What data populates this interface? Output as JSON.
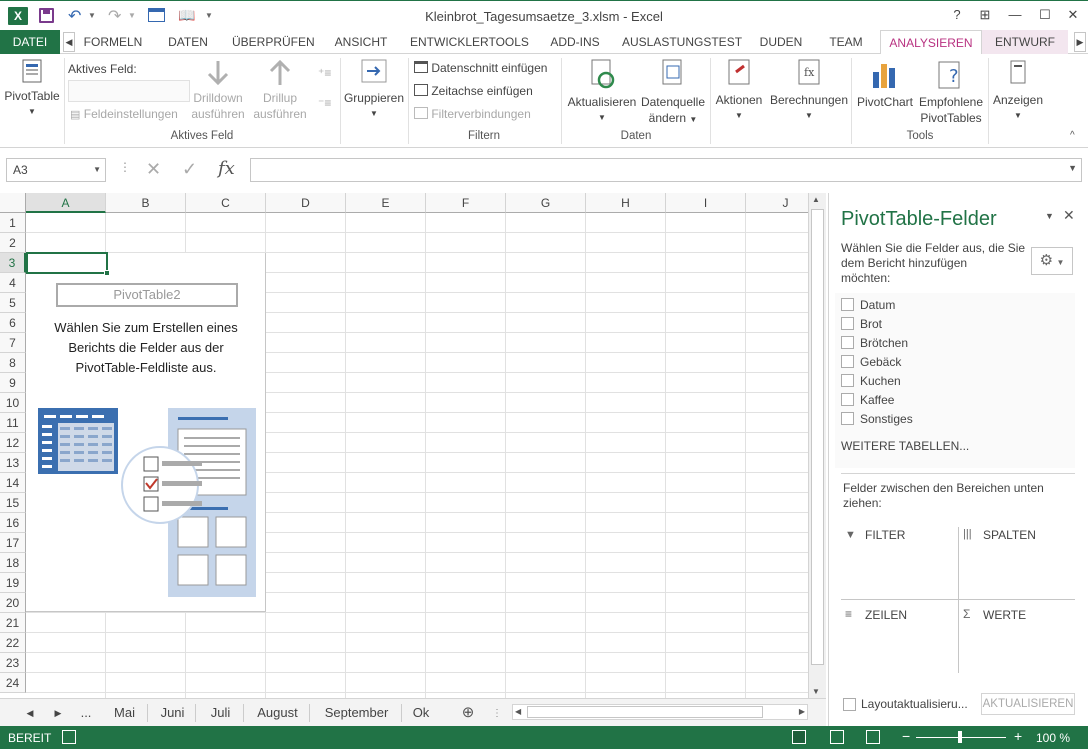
{
  "window": {
    "title": "Kleinbrot_Tagesumsaetze_3.xlsm - Excel",
    "help": "?",
    "ribbon_display": "⊞",
    "minimize": "—",
    "maximize": "☐",
    "close": "✕"
  },
  "tabs": [
    {
      "label": "DATEI"
    },
    {
      "label": "FORMELN"
    },
    {
      "label": "DATEN"
    },
    {
      "label": "ÜBERPRÜFEN"
    },
    {
      "label": "ANSICHT"
    },
    {
      "label": "ENTWICKLERTOOLS"
    },
    {
      "label": "ADD-INS"
    },
    {
      "label": "AUSLASTUNGSTEST"
    },
    {
      "label": "DUDEN"
    },
    {
      "label": "TEAM"
    },
    {
      "label": "ANALYSIEREN"
    },
    {
      "label": "ENTWURF"
    }
  ],
  "ribbon": {
    "pivottable": "PivotTable",
    "active_field_label": "Aktives Feld:",
    "field_settings": "Feldeinstellungen",
    "drilldown_1": "Drilldown",
    "drilldown_2": "ausführen",
    "drillup_1": "Drillup",
    "drillup_2": "ausführen",
    "group_active_field": "Aktives Feld",
    "gruppieren": "Gruppieren",
    "slicer": "Datenschnitt einfügen",
    "timeline": "Zeitachse einfügen",
    "filter_conn": "Filterverbindungen",
    "group_filter": "Filtern",
    "refresh": "Aktualisieren",
    "datasource_1": "Datenquelle",
    "datasource_2": "ändern",
    "group_daten": "Daten",
    "actions": "Aktionen",
    "calculations": "Berechnungen",
    "pivotchart": "PivotChart",
    "recommended_1": "Empfohlene",
    "recommended_2": "PivotTables",
    "group_tools": "Tools",
    "show": "Anzeigen"
  },
  "formula_bar": {
    "name_box": "A3",
    "cancel_icon": "✕",
    "enter_icon": "✓",
    "fx": "fx",
    "value": ""
  },
  "grid": {
    "columns": [
      "A",
      "B",
      "C",
      "D",
      "E",
      "F",
      "G",
      "H",
      "I",
      "J"
    ],
    "rows": [
      "1",
      "2",
      "3",
      "4",
      "5",
      "6",
      "7",
      "8",
      "9",
      "10",
      "11",
      "12",
      "13",
      "14",
      "15",
      "16",
      "17",
      "18",
      "19",
      "20",
      "21",
      "22",
      "23",
      "24"
    ],
    "active_cell": "A3"
  },
  "pivot_placeholder": {
    "name": "PivotTable2",
    "line1": "Wählen Sie zum Erstellen eines",
    "line2": "Berichts die Felder aus der",
    "line3": "PivotTable-Feldliste aus."
  },
  "sheet_tabs": {
    "ellipsis": "...",
    "tabs": [
      "Mai",
      "Juni",
      "Juli",
      "August",
      "September",
      "Ok"
    ]
  },
  "status": {
    "ready": "BEREIT",
    "zoom": "100 %"
  },
  "panel": {
    "title": "PivotTable-Felder",
    "description_1": "Wählen Sie die Felder aus, die Sie",
    "description_2": "dem Bericht hinzufügen",
    "description_3": "möchten:",
    "fields": [
      "Datum",
      "Brot",
      "Brötchen",
      "Gebäck",
      "Kuchen",
      "Kaffee",
      "Sonstiges"
    ],
    "more_tables": "WEITERE TABELLEN...",
    "drag_1": "Felder zwischen den Bereichen unten",
    "drag_2": "ziehen:",
    "area_filter": "FILTER",
    "area_columns": "SPALTEN",
    "area_rows": "ZEILEN",
    "area_values": "WERTE",
    "defer_update": "Layoutaktualisieru...",
    "update_button": "AKTUALISIEREN"
  },
  "colors": {
    "excel_green": "#217346",
    "context_tab": "#b83281",
    "context_bg": "#f3e6ef"
  }
}
